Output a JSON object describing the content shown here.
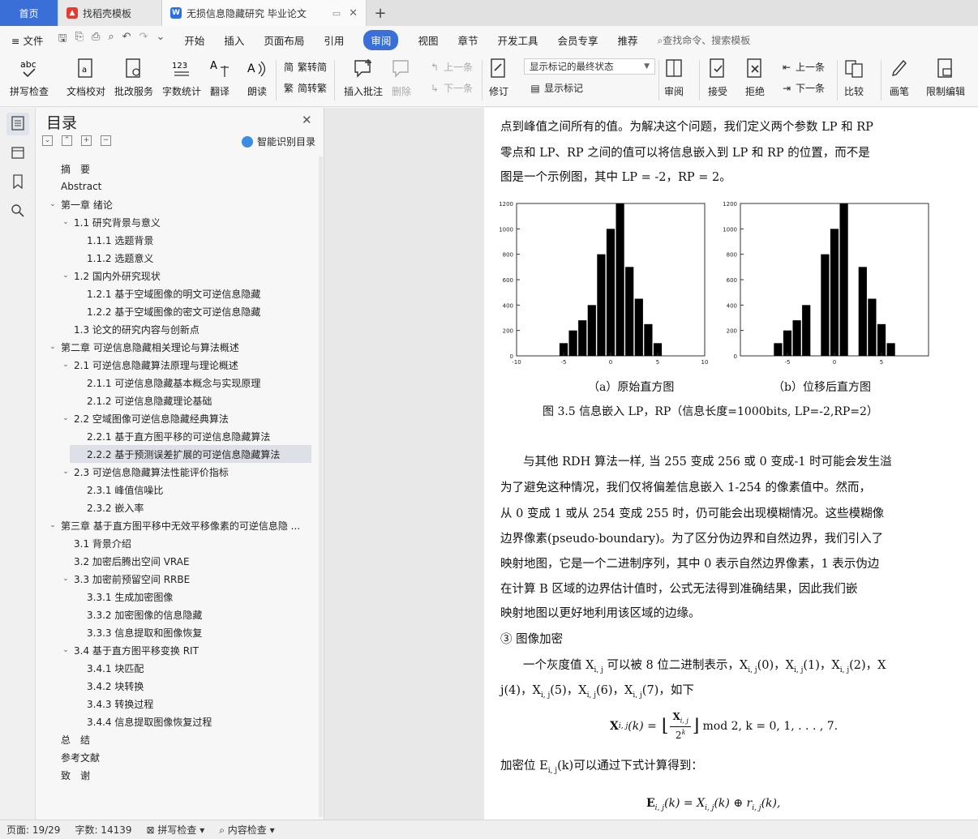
{
  "tabs": [
    {
      "label": "首页"
    },
    {
      "label": "找稻壳模板"
    },
    {
      "label": "无损信息隐藏研究 毕业论文"
    }
  ],
  "menu": {
    "file": "文件",
    "items": [
      "开始",
      "插入",
      "页面布局",
      "引用",
      "审阅",
      "视图",
      "章节",
      "开发工具",
      "会员专享",
      "推荐"
    ],
    "active": "审阅",
    "search": "查找命令、搜索模板"
  },
  "ribbon": {
    "spell": "拼写检查",
    "proof": "文档校对",
    "annotate_service": "批改服务",
    "word_count": "字数统计",
    "translate": "翻译",
    "read_aloud": "朗读",
    "trad": "繁转简",
    "simp": "简转繁",
    "insert_comment": "插入批注",
    "delete": "删除",
    "prev": "上一条",
    "next": "下一条",
    "revise": "修订",
    "markup_state": "显示标记的最终状态",
    "show_markup": "显示标记",
    "review": "审阅",
    "accept": "接受",
    "reject": "拒绝",
    "prev2": "上一条",
    "next2": "下一条",
    "compare": "比较",
    "pen": "画笔",
    "restrict": "限制编辑"
  },
  "toc": {
    "title": "目录",
    "smart": "智能识别目录",
    "items": [
      {
        "text": "摘　要",
        "level": 0,
        "caret": ""
      },
      {
        "text": "Abstract",
        "level": 0,
        "caret": ""
      },
      {
        "text": "第一章 绪论",
        "level": 0,
        "caret": "v"
      },
      {
        "text": "1.1 研究背景与意义",
        "level": 1,
        "caret": "v"
      },
      {
        "text": "1.1.1 选题背景",
        "level": 2,
        "caret": ""
      },
      {
        "text": "1.1.2 选题意义",
        "level": 2,
        "caret": ""
      },
      {
        "text": "1.2 国内外研究现状",
        "level": 1,
        "caret": "v"
      },
      {
        "text": "1.2.1 基于空域图像的明文可逆信息隐藏",
        "level": 2,
        "caret": ""
      },
      {
        "text": "1.2.2 基于空域图像的密文可逆信息隐藏",
        "level": 2,
        "caret": ""
      },
      {
        "text": "1.3 论文的研究内容与创新点",
        "level": 1,
        "caret": ""
      },
      {
        "text": "第二章 可逆信息隐藏相关理论与算法概述",
        "level": 0,
        "caret": "v"
      },
      {
        "text": "2.1 可逆信息隐藏算法原理与理论概述",
        "level": 1,
        "caret": "v"
      },
      {
        "text": "2.1.1 可逆信息隐藏基本概念与实现原理",
        "level": 2,
        "caret": ""
      },
      {
        "text": "2.1.2 可逆信息隐藏理论基础",
        "level": 2,
        "caret": ""
      },
      {
        "text": "2.2 空域图像可逆信息隐藏经典算法",
        "level": 1,
        "caret": "v"
      },
      {
        "text": "2.2.1 基于直方图平移的可逆信息隐藏算法",
        "level": 2,
        "caret": ""
      },
      {
        "text": "2.2.2 基于预测误差扩展的可逆信息隐藏算法",
        "level": 2,
        "caret": "",
        "selected": true
      },
      {
        "text": "2.3 可逆信息隐藏算法性能评价指标",
        "level": 1,
        "caret": "v"
      },
      {
        "text": "2.3.1 峰值信噪比",
        "level": 2,
        "caret": ""
      },
      {
        "text": "2.3.2 嵌入率",
        "level": 2,
        "caret": ""
      },
      {
        "text": "第三章 基于直方图平移中无效平移像素的可逆信息隐 ...",
        "level": 0,
        "caret": "v"
      },
      {
        "text": "3.1 背景介绍",
        "level": 1,
        "caret": ""
      },
      {
        "text": "3.2 加密后腾出空间 VRAE",
        "level": 1,
        "caret": ""
      },
      {
        "text": "3.3 加密前预留空间 RRBE",
        "level": 1,
        "caret": "v"
      },
      {
        "text": "3.3.1 生成加密图像",
        "level": 2,
        "caret": ""
      },
      {
        "text": "3.3.2 加密图像的信息隐藏",
        "level": 2,
        "caret": ""
      },
      {
        "text": "3.3.3 信息提取和图像恢复",
        "level": 2,
        "caret": ""
      },
      {
        "text": "3.4 基于直方图平移变换 RIT",
        "level": 1,
        "caret": "v"
      },
      {
        "text": "3.4.1 块匹配",
        "level": 2,
        "caret": ""
      },
      {
        "text": "3.4.2 块转换",
        "level": 2,
        "caret": ""
      },
      {
        "text": "3.4.3 转换过程",
        "level": 2,
        "caret": ""
      },
      {
        "text": "3.4.4 信息提取图像恢复过程",
        "level": 2,
        "caret": ""
      },
      {
        "text": "总　结",
        "level": 0,
        "caret": ""
      },
      {
        "text": "参考文献",
        "level": 0,
        "caret": ""
      },
      {
        "text": "致　谢",
        "level": 0,
        "caret": ""
      }
    ]
  },
  "doc": {
    "line1": "点到峰值之间所有的值。为解决这个问题，我们定义两个参数 LP 和 RP",
    "line2": "零点和 LP、RP 之间的值可以将信息嵌入到 LP 和 RP 的位置，而不是",
    "line3": "图是一个示例图，其中 LP = -2，RP = 2。",
    "cap_a": "（a）原始直方图",
    "cap_b": "（b）位移后直方图",
    "fig_caption": "图 3.5  信息嵌入 LP，RP（信息长度=1000bits, LP=-2,RP=2）",
    "p2_1": "与其他 RDH 算法一样, 当 255 变成 256 或 0 变成-1 时可能会发生溢",
    "p2_2": "为了避免这种情况，我们仅将偏差信息嵌入 1-254 的像素值中。然而，",
    "p2_3": "从 0 变成 1 或从 254 变成 255 时，仍可能会出现模糊情况。这些模糊像",
    "p2_4": "边界像素(pseudo-boundary)。为了区分伪边界和自然边界，我们引入了",
    "p2_5": "映射地图，它是一个二进制序列，其中 0 表示自然边界像素，1 表示伪边",
    "p2_6": "在计算 B 区域的边界估计值时，公式无法得到准确结果，因此我们嵌",
    "p2_7": "映射地图以更好地利用该区域的边缘。",
    "h3": "③  图像加密",
    "p3_1a": "一个灰度值 X",
    "p3_1sub": "i, j",
    "p3_1b": " 可以被 8 位二进制表示，X",
    "p3_1c": "(0)，X",
    "p3_1d": "(1)，X",
    "p3_1e": "(2)，X",
    "p3_2": "j(4)，X",
    "p3_2b": "(5)，X",
    "p3_2c": "(6)，X",
    "p3_2d": "(7)，如下",
    "formula1": "X",
    "formula1_tail": "mod 2,    k = 0, 1, . . . , 7.",
    "formula1_frac_top": "X",
    "formula1_frac_bot": "2",
    "p4": "加密位 E",
    "p4_tail": "(k)可以通过下式计算得到：",
    "formula2": "E",
    "formula2_tail": "(k) = X",
    "formula2_tail2": "(k) ⊕ r",
    "formula2_tail3": "(k),"
  },
  "chart_data": [
    {
      "type": "bar",
      "categories": [
        -5,
        -4,
        -3,
        -2,
        -1,
        0,
        1,
        2,
        3,
        4,
        5
      ],
      "values": [
        100,
        200,
        280,
        400,
        800,
        1000,
        1200,
        700,
        450,
        250,
        100
      ],
      "xlim": [
        -10,
        10
      ],
      "ylim": [
        0,
        1200
      ],
      "xticks": [
        -10,
        -5,
        0,
        5,
        10
      ],
      "yticks": [
        0,
        200,
        400,
        600,
        800,
        1000,
        1200
      ]
    },
    {
      "type": "bar",
      "categories": [
        -6,
        -5,
        -4,
        -3,
        -1,
        0,
        1,
        3,
        4,
        5,
        6
      ],
      "values": [
        100,
        200,
        280,
        400,
        800,
        1000,
        1200,
        700,
        450,
        250,
        100
      ],
      "xlim": [
        -10,
        10
      ],
      "ylim": [
        0,
        1200
      ],
      "xticks": [
        -5,
        0,
        5
      ],
      "yticks": [
        0,
        200,
        400,
        600,
        800,
        1000,
        1200
      ]
    }
  ],
  "status": {
    "page": "页面: 19/29",
    "words": "字数: 14139",
    "spell": "拼写检查",
    "content": "内容检查"
  }
}
